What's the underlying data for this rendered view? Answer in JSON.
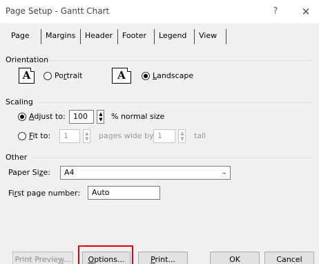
{
  "window": {
    "title": "Page Setup - Gantt Chart",
    "help_glyph": "?",
    "close_glyph": "✕"
  },
  "tabs": [
    {
      "label": "Page",
      "selected": true
    },
    {
      "label": "Margins"
    },
    {
      "label": "Header"
    },
    {
      "label": "Footer"
    },
    {
      "label": "Legend"
    },
    {
      "label": "View"
    }
  ],
  "orientation": {
    "heading": "Orientation",
    "icon_glyph": "A",
    "portrait_label": "Portrait",
    "landscape_label": "Landscape",
    "selected": "landscape"
  },
  "scaling": {
    "heading": "Scaling",
    "adjust_label": "Adjust to:",
    "adjust_value": "100",
    "adjust_suffix": "% normal size",
    "fit_label": "Fit to:",
    "fit_wide_value": "1",
    "fit_wide_suffix": "pages wide by",
    "fit_tall_value": "1",
    "fit_tall_suffix": "tall",
    "selected": "adjust"
  },
  "other": {
    "heading": "Other",
    "paper_size_label": "Paper Size:",
    "paper_size_value": "A4",
    "first_page_label": "First page number:",
    "first_page_value": "Auto"
  },
  "buttons": {
    "print_preview": "Print Preview...",
    "options": "Options...",
    "print": "Print...",
    "ok": "OK",
    "cancel": "Cancel"
  },
  "colors": {
    "highlight": "#e00000"
  }
}
